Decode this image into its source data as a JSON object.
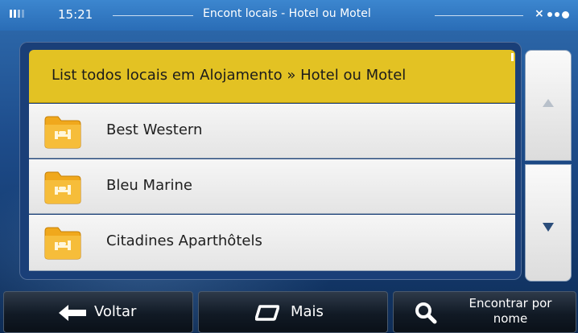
{
  "status_bar": {
    "time": "15:21",
    "title": "Encont locais - Hotel ou Motel"
  },
  "list": {
    "header": "List todos locais em Alojamento » Hotel ou Motel",
    "items": [
      {
        "label": "Best Western",
        "icon": "hotel-folder-icon"
      },
      {
        "label": "Bleu Marine",
        "icon": "hotel-folder-icon"
      },
      {
        "label": "Citadines Aparthôtels",
        "icon": "hotel-folder-icon"
      }
    ]
  },
  "scroll": {
    "up_icon": "scroll-up-arrow-icon",
    "down_icon": "scroll-down-arrow-icon"
  },
  "toolbar": {
    "back_label": "Voltar",
    "more_label": "Mais",
    "find_by_name_label": "Encontrar por nome"
  },
  "colors": {
    "header_yellow": "#e3c223",
    "background_blue": "#1e4d8c",
    "folder_orange": "#f0a81c"
  }
}
